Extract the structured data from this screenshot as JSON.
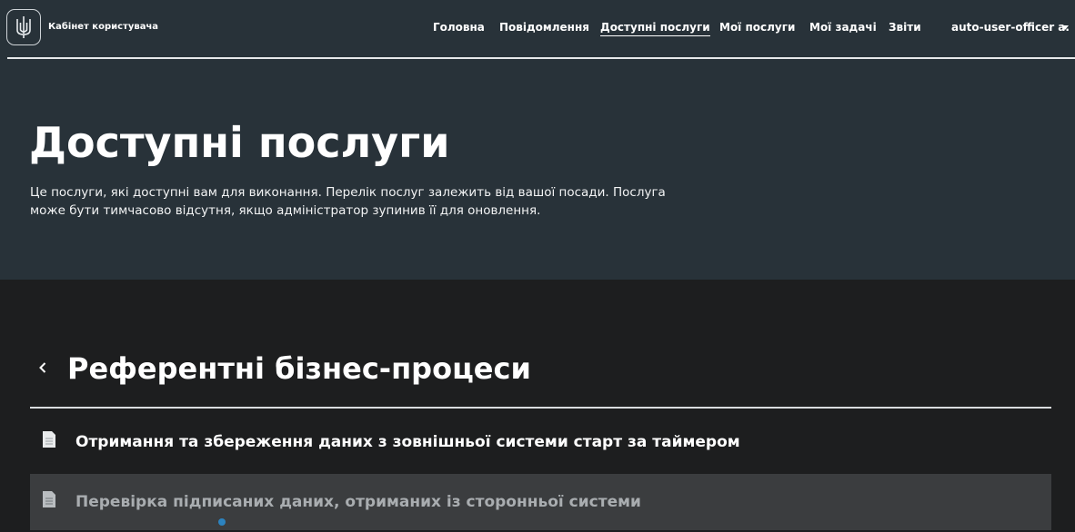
{
  "header": {
    "brand": "Кабінет користувача",
    "nav": [
      {
        "label": "Головна",
        "active": false
      },
      {
        "label": "Повідомлення",
        "active": false
      },
      {
        "label": "Доступні послуги",
        "active": true
      },
      {
        "label": "Мої послуги",
        "active": false
      },
      {
        "label": "Мої задачі",
        "active": false
      },
      {
        "label": "Звіти",
        "active": false
      }
    ],
    "user": "auto-user-officer a.",
    "icons": {
      "logo": "trident-icon",
      "dropdown": "caret-down-icon"
    }
  },
  "page": {
    "title": "Доступні послуги",
    "description": "Це послуги, які доступні вам для виконання. Перелік послуг залежить від вашої посади. Послуга може бути тимчасово відсутня, якщо адміністратор зупинив її для оновлення."
  },
  "section": {
    "title": "Референтні бізнес-процеси",
    "back_icon": "chevron-left-icon",
    "items": [
      {
        "label": "Отримання та збереження даних з зовнішньої системи старт за таймером",
        "icon": "document-icon"
      },
      {
        "label": "Перевірка підписаних даних, отриманих із сторонньої системи",
        "icon": "document-icon"
      }
    ]
  },
  "colors": {
    "header_bg": "#283239",
    "body_bg": "#1d1e1f",
    "hover_row_bg": "#3b3d3f",
    "text": "#ffffff"
  }
}
